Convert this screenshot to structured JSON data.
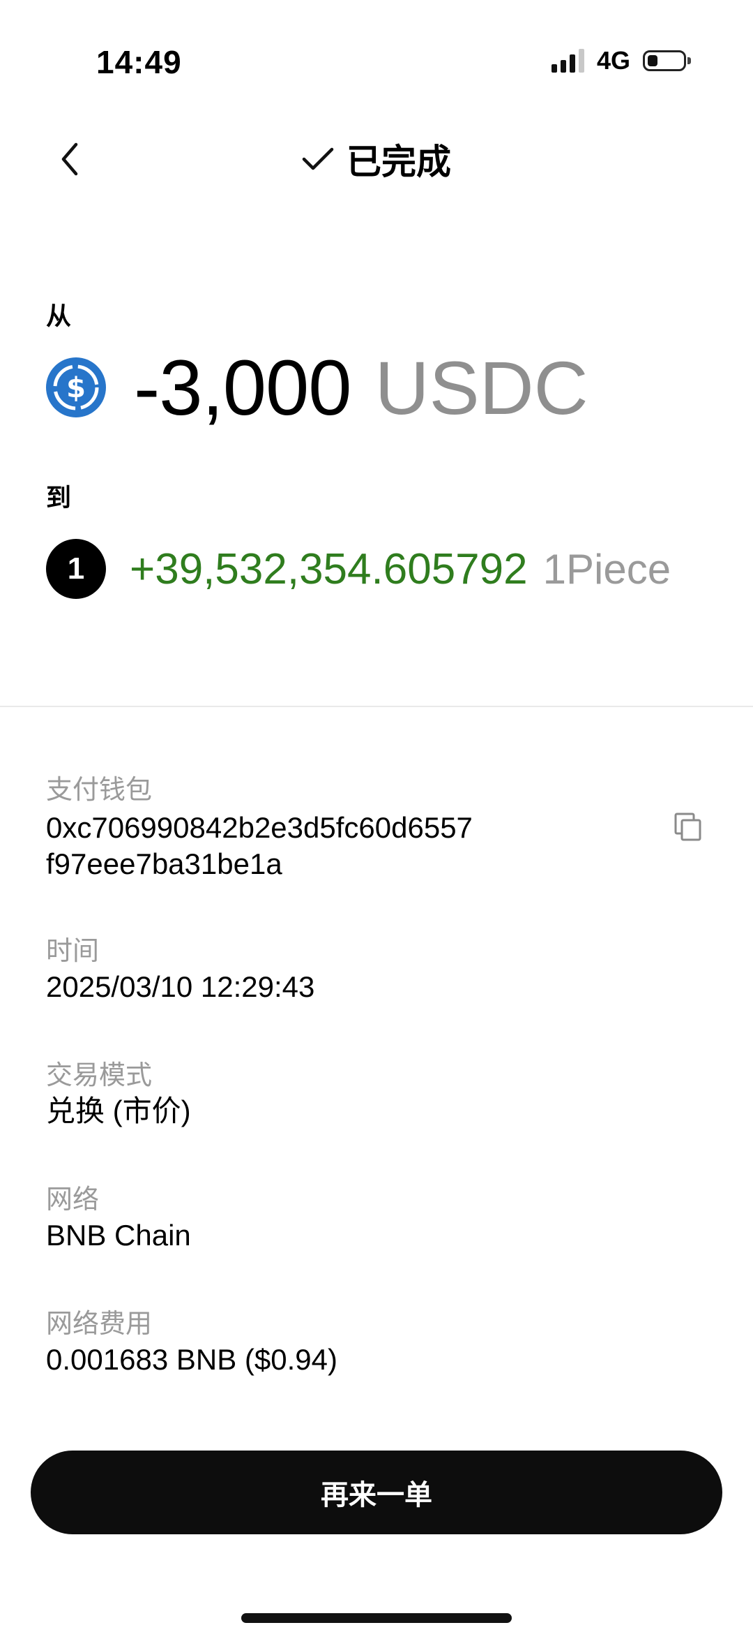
{
  "status_bar": {
    "time": "14:49",
    "network": "4G"
  },
  "header": {
    "title": "已完成",
    "status_icon": "check-icon",
    "back_icon": "chevron-left-icon"
  },
  "swap": {
    "from_label": "从",
    "from_amount": "-3,000",
    "from_unit": "USDC",
    "from_icon": "usdc-coin-icon",
    "to_label": "到",
    "to_amount": "+39,532,354.605792",
    "to_unit": "1Piece",
    "to_icon_text": "1"
  },
  "details": {
    "wallet_label": "支付钱包",
    "wallet_line1": "0xc706990842b2e3d5fc60d6557",
    "wallet_line2": "f97eee7ba31be1a",
    "time_label": "时间",
    "time_value": "2025/03/10 12:29:43",
    "mode_label": "交易模式",
    "mode_value": "兑换 (市价)",
    "network_label": "网络",
    "network_value": "BNB Chain",
    "fee_label": "网络费用",
    "fee_value": "0.001683 BNB ($0.94)"
  },
  "actions": {
    "primary_label": "再来一单"
  },
  "colors": {
    "positive": "#2f7d1e",
    "usdc_blue": "#2775ca",
    "muted": "#9a9a9a"
  }
}
